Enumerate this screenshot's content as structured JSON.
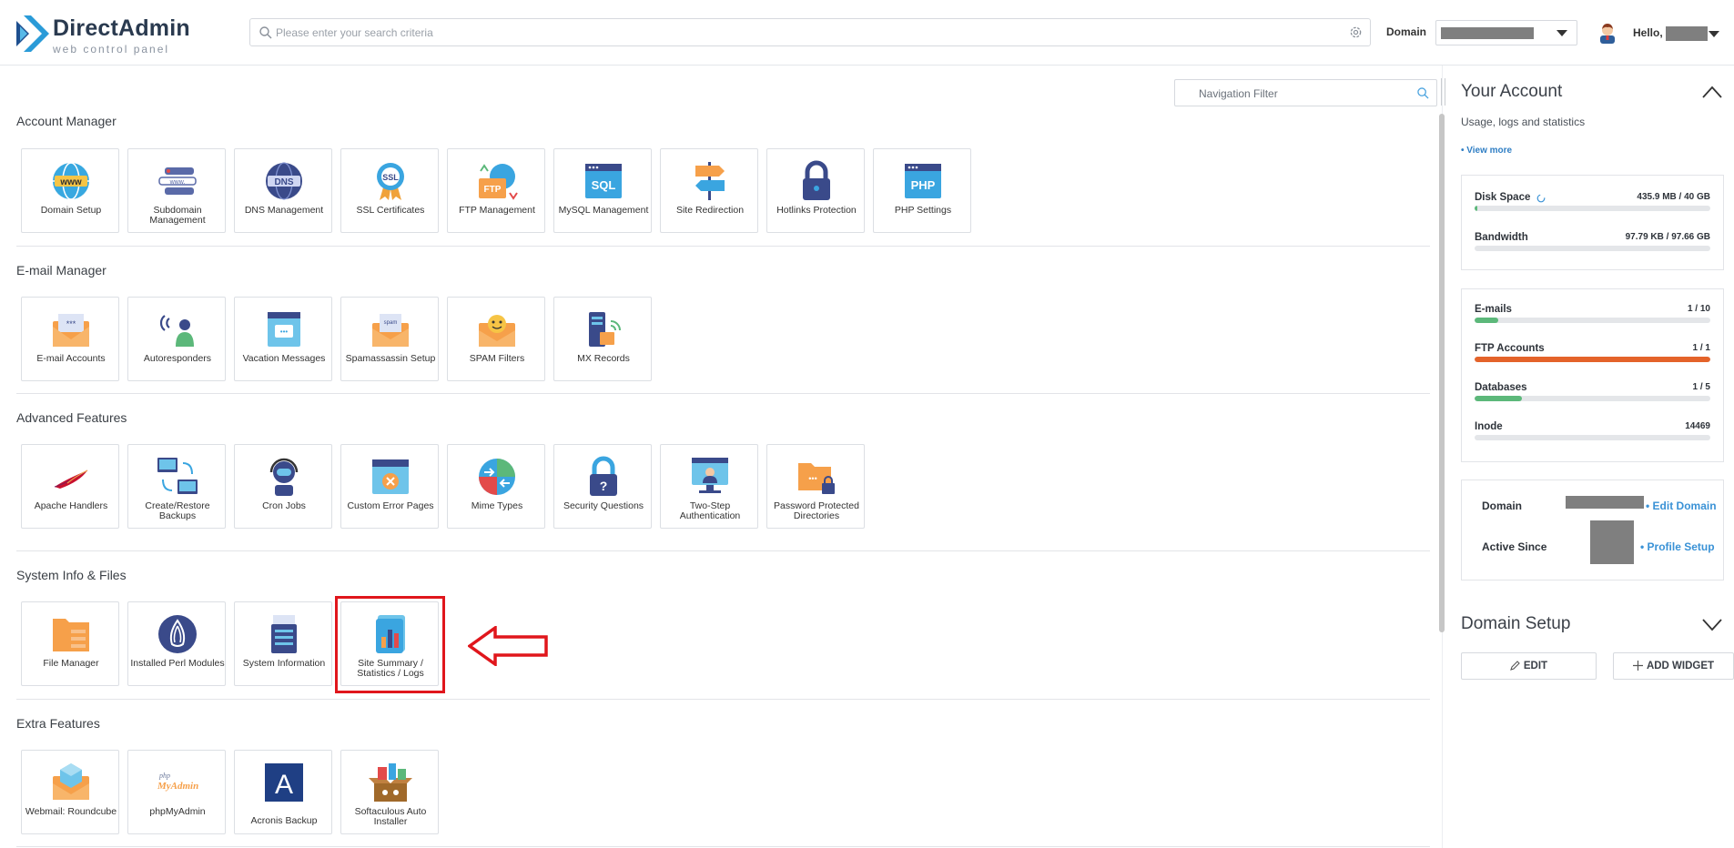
{
  "header": {
    "logo_name": "DirectAdmin",
    "logo_sub": "web control panel",
    "search_placeholder": "Please enter your search criteria",
    "domain_label": "Domain",
    "hello": "Hello,"
  },
  "nav_filter": {
    "placeholder": "Navigation Filter"
  },
  "sections": [
    {
      "title": "Account Manager",
      "tiles": [
        "Domain Setup",
        "Subdomain Management",
        "DNS Management",
        "SSL Certificates",
        "FTP Management",
        "MySQL Management",
        "Site Redirection",
        "Hotlinks Protection",
        "PHP Settings"
      ]
    },
    {
      "title": "E-mail Manager",
      "tiles": [
        "E-mail Accounts",
        "Autoresponders",
        "Vacation Messages",
        "Spamassassin Setup",
        "SPAM Filters",
        "MX Records"
      ]
    },
    {
      "title": "Advanced Features",
      "tiles": [
        "Apache Handlers",
        "Create/Restore Backups",
        "Cron Jobs",
        "Custom Error Pages",
        "Mime Types",
        "Security Questions",
        "Two-Step Authentication",
        "Password Protected Directories"
      ]
    },
    {
      "title": "System Info & Files",
      "tiles": [
        "File Manager",
        "Installed Perl Modules",
        "System Information",
        "Site Summary / Statistics / Logs"
      ]
    },
    {
      "title": "Extra Features",
      "tiles": [
        "Webmail: Roundcube",
        "phpMyAdmin",
        "Acronis Backup",
        "Softaculous Auto Installer"
      ]
    }
  ],
  "icons": {
    "ssl": "SSL",
    "ftp": "FTP",
    "sql": "SQL",
    "php": "PHP",
    "www": "www",
    "dns": "DNS",
    "pma_top": "php",
    "pma_bottom": "MyAdmin",
    "acronis": "A"
  },
  "your_account": {
    "title": "Your Account",
    "subtitle": "Usage, logs and statistics",
    "view_more": "• View more",
    "stats_top": [
      {
        "name": "Disk Space",
        "value": "435.9 MB / 40 GB",
        "fraction": 0.011,
        "color": "#5cb87a"
      },
      {
        "name": "Bandwidth",
        "value": "97.79 KB / 97.66 GB",
        "fraction": 0.0,
        "color": "#5cb87a"
      }
    ],
    "stats_bottom": [
      {
        "name": "E-mails",
        "value": "1 / 10",
        "fraction": 0.1,
        "color": "#5cb87a"
      },
      {
        "name": "FTP Accounts",
        "value": "1 / 1",
        "fraction": 1.0,
        "color": "#e4632a"
      },
      {
        "name": "Databases",
        "value": "1 / 5",
        "fraction": 0.2,
        "color": "#5cb87a"
      },
      {
        "name": "Inode",
        "value": "14469",
        "fraction": 0.0,
        "color": "#5cb87a"
      }
    ],
    "domain_label": "Domain",
    "edit_domain": "• Edit Domain",
    "active_since_label": "Active Since",
    "profile_setup": "• Profile Setup"
  },
  "domain_setup": {
    "title": "Domain Setup",
    "edit_label": "EDIT",
    "add_widget_label": "ADD WIDGET"
  },
  "colors": {
    "accent": "#2f7ec4",
    "highlight": "#e0161c"
  }
}
